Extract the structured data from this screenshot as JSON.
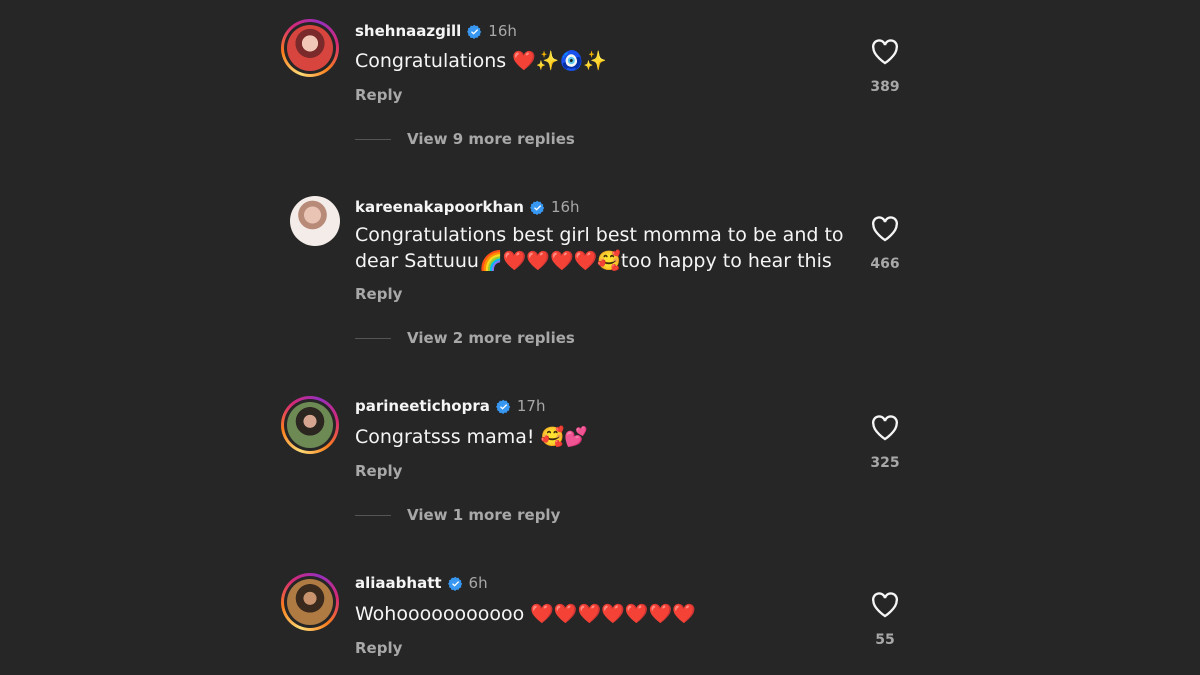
{
  "comments": [
    {
      "username": "shehnaazgill",
      "time": "16h",
      "text": "Congratulations ❤️✨🧿✨",
      "reply_label": "Reply",
      "likes": "389",
      "view_replies": "View 9 more replies"
    },
    {
      "username": "kareenakapoorkhan",
      "time": "16h",
      "text": "Congratulations best girl best momma to be and to dear Sattuuu🌈❤️❤️❤️❤️🥰too happy to hear this",
      "reply_label": "Reply",
      "likes": "466",
      "view_replies": "View 2 more replies"
    },
    {
      "username": "parineetichopra",
      "time": "17h",
      "text": "Congratsss mama! 🥰💕",
      "reply_label": "Reply",
      "likes": "325",
      "view_replies": "View 1 more reply"
    },
    {
      "username": "aliaabhatt",
      "time": "6h",
      "text": "Wohooooooooooo ❤️❤️❤️❤️❤️❤️❤️",
      "reply_label": "Reply",
      "likes": "55"
    }
  ],
  "colors": {
    "background": "#262626",
    "verified": "#3897f0",
    "secondary_text": "#a8a8a8"
  },
  "icons": {
    "like": "heart-outline-icon",
    "verified": "verified-badge-icon"
  }
}
